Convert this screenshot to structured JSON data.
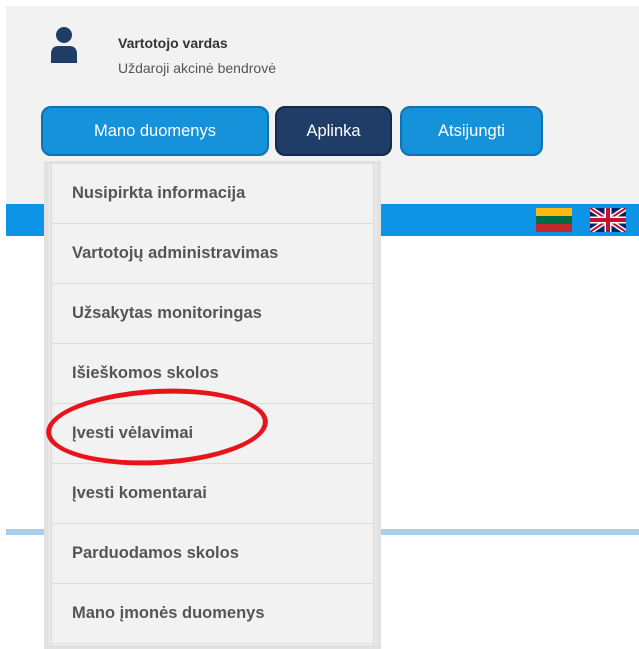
{
  "user": {
    "name": "Vartotojo vardas",
    "company": "Uždaroji akcinė bendrovė",
    "icon": "user-icon"
  },
  "nav": {
    "mano_label": "Mano duomenys",
    "aplinka_label": "Aplinka",
    "atsijungti_label": "Atsijungti"
  },
  "languages": {
    "lt_icon": "flag-lithuania-icon",
    "gb_icon": "flag-uk-icon"
  },
  "dropdown": {
    "items": [
      "Nusipirkta informacija",
      "Vartotojų administravimas",
      "Užsakytas monitoringas",
      "Išieškomos skolos",
      "Įvesti vėlavimai",
      "Įvesti komentarai",
      "Parduodamos skolos",
      "Mano įmonės duomenys"
    ],
    "highlighted_index": 4
  },
  "colors": {
    "nav_blue": "#1592d9",
    "nav_dark": "#1f3d67",
    "band_blue": "#0d94e6",
    "highlight_red": "#e8141b"
  }
}
